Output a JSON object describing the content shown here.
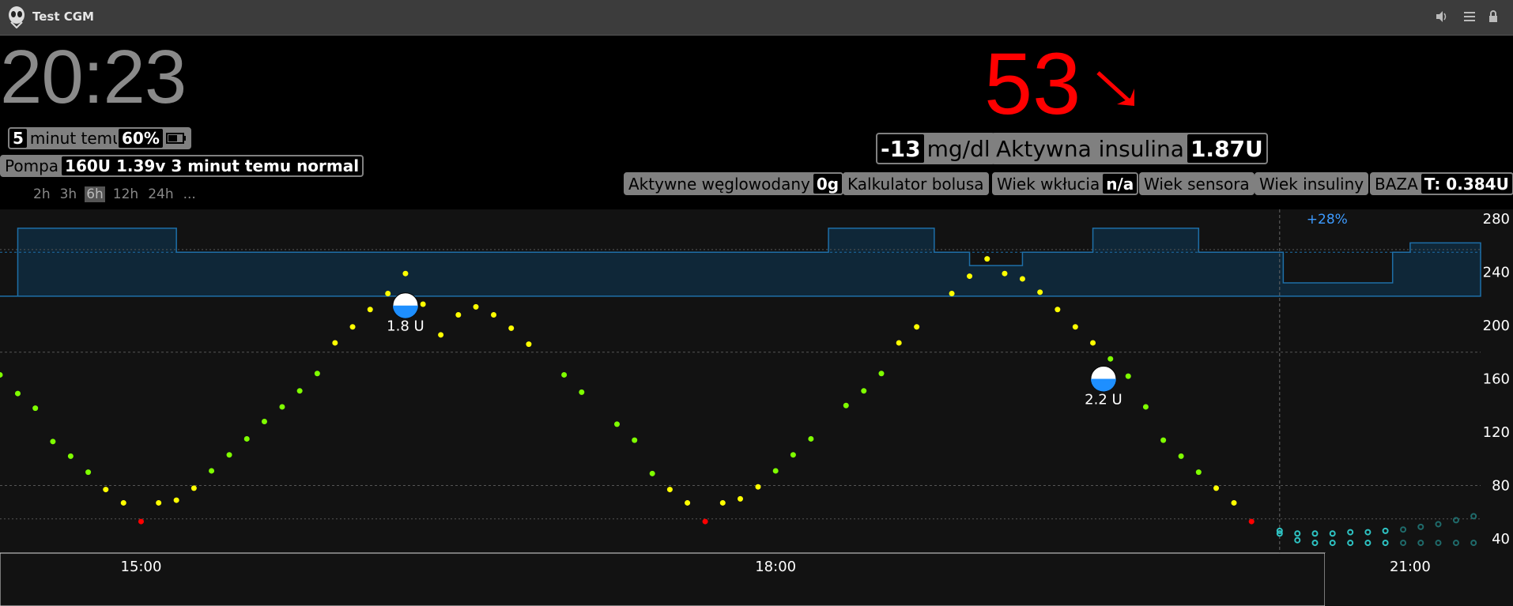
{
  "window": {
    "title": "Test CGM"
  },
  "clock": "20:23",
  "status": {
    "minutes": "5",
    "minutes_label": "minut temu",
    "battery": "60%"
  },
  "pump": {
    "label": "Pompa",
    "value": "160U 1.39v 3 minut temu normal"
  },
  "time_ranges": [
    "2h",
    "3h",
    "6h",
    "12h",
    "24h",
    "..."
  ],
  "time_range_selected": "6h",
  "bg": {
    "value": "53",
    "color": "#ff0000",
    "trend": "single-down-right-arrow",
    "delta": "-13",
    "unit": "mg/dl"
  },
  "iob": {
    "label": "Aktywna insulina",
    "value": "1.87U"
  },
  "pills": {
    "cob_label": "Aktywne węglowodany",
    "cob_value": "0g",
    "bolus_calc": "Kalkulator bolusa",
    "cannula_label": "Wiek wkłucia",
    "cannula_value": "n/a",
    "sensor_age": "Wiek sensora",
    "insulin_age": "Wiek insuliny",
    "basal_label": "BAZA",
    "basal_value": "T: 0.384U"
  },
  "chart_data": {
    "type": "scatter",
    "x_labels": [
      "15:00",
      "18:00",
      "21:00"
    ],
    "y_ticks": [
      40,
      80,
      120,
      160,
      200,
      240,
      280
    ],
    "ylim": [
      30,
      285
    ],
    "xlim_hours": [
      14.333,
      21.333
    ],
    "now_hour": 20.383,
    "target_range": [
      60,
      180
    ],
    "temp_basal_label": "+28%",
    "colors": {
      "in_range": "#7fff00",
      "high": "#ffff00",
      "low": "#ff0000",
      "forecast": "#2ec4c4",
      "basal": "#1e6fa8"
    },
    "treatments": [
      {
        "hour": 16.25,
        "value": 215,
        "label": "1.8 U"
      },
      {
        "hour": 19.55,
        "value": 160,
        "label": "2.2 U"
      }
    ],
    "sgv": [
      [
        14.333,
        163
      ],
      [
        14.417,
        149
      ],
      [
        14.5,
        138
      ],
      [
        14.583,
        113
      ],
      [
        14.667,
        102
      ],
      [
        14.75,
        90
      ],
      [
        14.833,
        77
      ],
      [
        14.917,
        67
      ],
      [
        15.0,
        53
      ],
      [
        15.083,
        67
      ],
      [
        15.167,
        69
      ],
      [
        15.25,
        78
      ],
      [
        15.333,
        91
      ],
      [
        15.417,
        103
      ],
      [
        15.5,
        115
      ],
      [
        15.583,
        128
      ],
      [
        15.667,
        139
      ],
      [
        15.75,
        151
      ],
      [
        15.833,
        164
      ],
      [
        15.917,
        187
      ],
      [
        16.0,
        199
      ],
      [
        16.083,
        212
      ],
      [
        16.167,
        224
      ],
      [
        16.25,
        239
      ],
      [
        16.333,
        216
      ],
      [
        16.417,
        193
      ],
      [
        16.5,
        208
      ],
      [
        16.583,
        214
      ],
      [
        16.667,
        208
      ],
      [
        16.75,
        198
      ],
      [
        16.833,
        186
      ],
      [
        17.0,
        163
      ],
      [
        17.083,
        150
      ],
      [
        17.25,
        126
      ],
      [
        17.333,
        114
      ],
      [
        17.417,
        89
      ],
      [
        17.5,
        77
      ],
      [
        17.583,
        67
      ],
      [
        17.667,
        53
      ],
      [
        17.75,
        67
      ],
      [
        17.833,
        70
      ],
      [
        17.917,
        79
      ],
      [
        18.0,
        91
      ],
      [
        18.083,
        103
      ],
      [
        18.167,
        115
      ],
      [
        18.333,
        140
      ],
      [
        18.417,
        151
      ],
      [
        18.5,
        164
      ],
      [
        18.583,
        187
      ],
      [
        18.667,
        199
      ],
      [
        18.833,
        224
      ],
      [
        18.917,
        237
      ],
      [
        19.0,
        250
      ],
      [
        19.083,
        239
      ],
      [
        19.167,
        235
      ],
      [
        19.25,
        225
      ],
      [
        19.333,
        212
      ],
      [
        19.417,
        199
      ],
      [
        19.5,
        187
      ],
      [
        19.583,
        175
      ],
      [
        19.667,
        162
      ],
      [
        19.75,
        139
      ],
      [
        19.833,
        114
      ],
      [
        19.917,
        102
      ],
      [
        20.0,
        90
      ],
      [
        20.083,
        78
      ],
      [
        20.167,
        67
      ],
      [
        20.25,
        53
      ]
    ],
    "forecast_upper": [
      [
        20.383,
        46
      ],
      [
        20.467,
        44
      ],
      [
        20.55,
        44
      ],
      [
        20.633,
        44
      ],
      [
        20.717,
        45
      ],
      [
        20.8,
        45
      ],
      [
        20.883,
        46
      ],
      [
        20.967,
        47
      ],
      [
        21.05,
        49
      ],
      [
        21.133,
        51
      ],
      [
        21.217,
        54
      ],
      [
        21.3,
        57
      ]
    ],
    "forecast_lower": [
      [
        20.383,
        44
      ],
      [
        20.467,
        39
      ],
      [
        20.55,
        37
      ],
      [
        20.633,
        37
      ],
      [
        20.717,
        37
      ],
      [
        20.8,
        37
      ],
      [
        20.883,
        37
      ],
      [
        20.967,
        37
      ],
      [
        21.05,
        37
      ],
      [
        21.133,
        37
      ],
      [
        21.217,
        37
      ],
      [
        21.3,
        37
      ]
    ],
    "basal_steps": [
      [
        14.333,
        222
      ],
      [
        14.417,
        273
      ],
      [
        15.167,
        255
      ],
      [
        18.25,
        273
      ],
      [
        18.75,
        255
      ],
      [
        18.917,
        245
      ],
      [
        19.167,
        255
      ],
      [
        19.5,
        273
      ],
      [
        20.0,
        255
      ],
      [
        20.4,
        232
      ],
      [
        20.917,
        255
      ],
      [
        21.0,
        262
      ],
      [
        21.333,
        255
      ]
    ]
  }
}
